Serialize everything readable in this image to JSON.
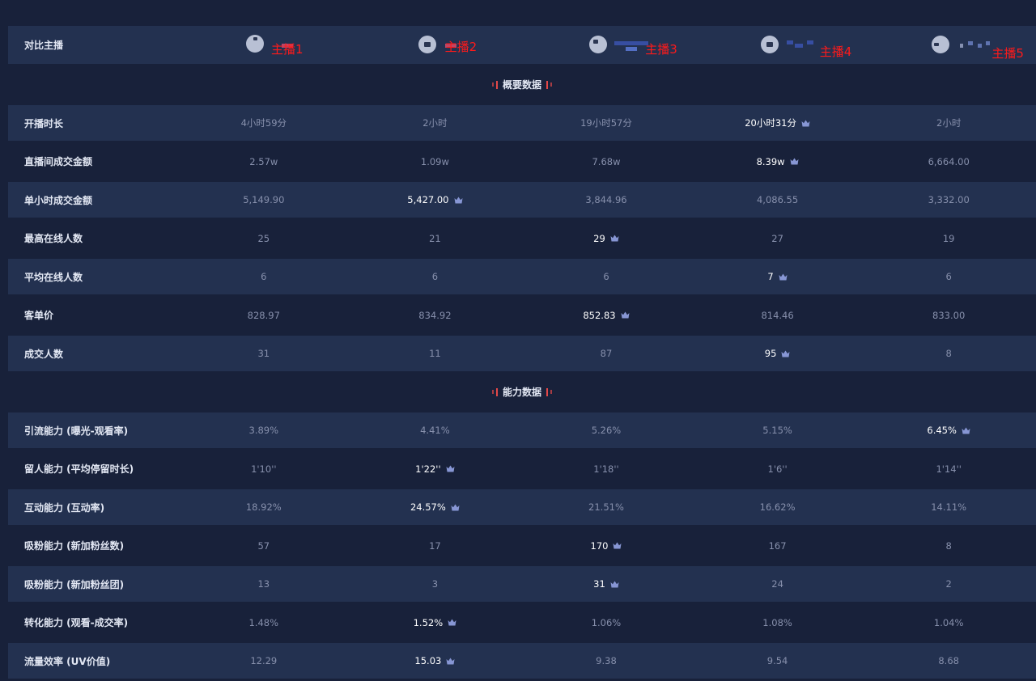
{
  "compare_label": "对比主播",
  "anchors": [
    "主播1",
    "主播2",
    "主播3",
    "主播4",
    "主播5"
  ],
  "sections": [
    {
      "title": "概要数据",
      "rows": [
        {
          "label": "开播时长",
          "values": [
            "4小时59分",
            "2小时",
            "19小时57分",
            "20小时31分",
            "2小时"
          ],
          "best": 3
        },
        {
          "label": "直播间成交金额",
          "values": [
            "2.57w",
            "1.09w",
            "7.68w",
            "8.39w",
            "6,664.00"
          ],
          "best": 3
        },
        {
          "label": "单小时成交金额",
          "values": [
            "5,149.90",
            "5,427.00",
            "3,844.96",
            "4,086.55",
            "3,332.00"
          ],
          "best": 1
        },
        {
          "label": "最高在线人数",
          "values": [
            "25",
            "21",
            "29",
            "27",
            "19"
          ],
          "best": 2
        },
        {
          "label": "平均在线人数",
          "values": [
            "6",
            "6",
            "6",
            "7",
            "6"
          ],
          "best": 3
        },
        {
          "label": "客单价",
          "values": [
            "828.97",
            "834.92",
            "852.83",
            "814.46",
            "833.00"
          ],
          "best": 2
        },
        {
          "label": "成交人数",
          "values": [
            "31",
            "11",
            "87",
            "95",
            "8"
          ],
          "best": 3
        }
      ]
    },
    {
      "title": "能力数据",
      "rows": [
        {
          "label": "引流能力 (曝光-观看率)",
          "values": [
            "3.89%",
            "4.41%",
            "5.26%",
            "5.15%",
            "6.45%"
          ],
          "best": 4
        },
        {
          "label": "留人能力 (平均停留时长)",
          "values": [
            "1'10''",
            "1'22''",
            "1'18''",
            "1'6''",
            "1'14''"
          ],
          "best": 1
        },
        {
          "label": "互动能力 (互动率)",
          "values": [
            "18.92%",
            "24.57%",
            "21.51%",
            "16.62%",
            "14.11%"
          ],
          "best": 1
        },
        {
          "label": "吸粉能力 (新加粉丝数)",
          "values": [
            "57",
            "17",
            "170",
            "167",
            "8"
          ],
          "best": 2
        },
        {
          "label": "吸粉能力 (新加粉丝团)",
          "values": [
            "13",
            "3",
            "31",
            "24",
            "2"
          ],
          "best": 2
        },
        {
          "label": "转化能力 (观看-成交率)",
          "values": [
            "1.48%",
            "1.52%",
            "1.06%",
            "1.08%",
            "1.04%"
          ],
          "best": 1
        },
        {
          "label": "流量效率 (UV价值)",
          "values": [
            "12.29",
            "15.03",
            "9.38",
            "9.54",
            "8.68"
          ],
          "best": 1
        }
      ]
    }
  ]
}
